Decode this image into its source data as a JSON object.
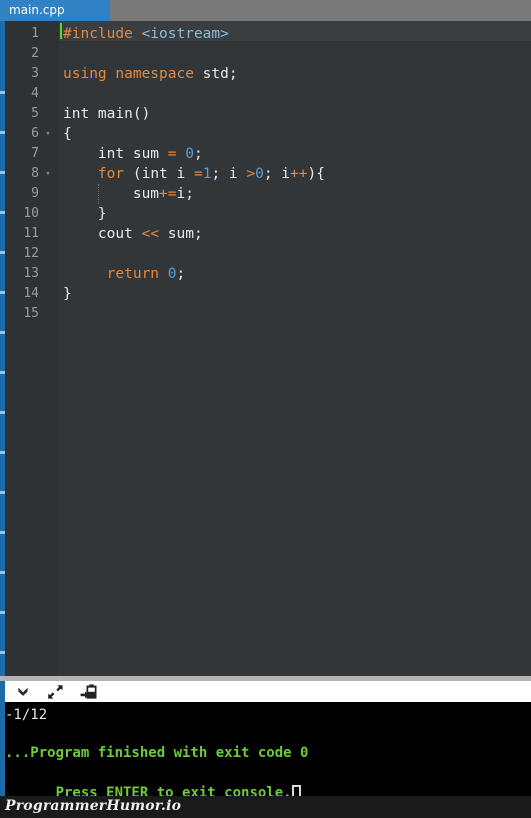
{
  "tabbar": {
    "active_tab": "main.cpp"
  },
  "editor": {
    "background": "#333638",
    "gutter_background": "#2f3234",
    "current_line_highlight": "#3b3e40",
    "cursor_color": "#4bdd2a",
    "colors": {
      "keyword": "#e8883a",
      "include_path": "#87bdd8",
      "number": "#5a9fd4",
      "plain": "#e8e8e8",
      "line_number": "#9a9c9d"
    },
    "lines": [
      {
        "num": "1",
        "fold": "",
        "indent": 0,
        "tokens": [
          {
            "t": "#include",
            "c": "k"
          },
          {
            "t": " ",
            "c": "p"
          },
          {
            "t": "<iostream>",
            "c": "s"
          }
        ]
      },
      {
        "num": "2",
        "fold": "",
        "indent": 0,
        "tokens": []
      },
      {
        "num": "3",
        "fold": "",
        "indent": 0,
        "tokens": [
          {
            "t": "using namespace",
            "c": "k"
          },
          {
            "t": " std;",
            "c": "p"
          }
        ]
      },
      {
        "num": "4",
        "fold": "",
        "indent": 0,
        "tokens": []
      },
      {
        "num": "5",
        "fold": "",
        "indent": 0,
        "tokens": [
          {
            "t": "int main()",
            "c": "p"
          }
        ]
      },
      {
        "num": "6",
        "fold": "▾",
        "indent": 0,
        "tokens": [
          {
            "t": "{",
            "c": "p"
          }
        ]
      },
      {
        "num": "7",
        "fold": "",
        "indent": 0,
        "tokens": [
          {
            "t": "    int sum ",
            "c": "p"
          },
          {
            "t": "=",
            "c": "k"
          },
          {
            "t": " ",
            "c": "p"
          },
          {
            "t": "0",
            "c": "n"
          },
          {
            "t": ";",
            "c": "p"
          }
        ]
      },
      {
        "num": "8",
        "fold": "▾",
        "indent": 0,
        "tokens": [
          {
            "t": "    ",
            "c": "p"
          },
          {
            "t": "for",
            "c": "k"
          },
          {
            "t": " (int i ",
            "c": "p"
          },
          {
            "t": "=",
            "c": "k"
          },
          {
            "t": "1",
            "c": "n"
          },
          {
            "t": "; i ",
            "c": "p"
          },
          {
            "t": ">",
            "c": "k"
          },
          {
            "t": "0",
            "c": "n"
          },
          {
            "t": "; i",
            "c": "p"
          },
          {
            "t": "++",
            "c": "k"
          },
          {
            "t": "){",
            "c": "p"
          }
        ]
      },
      {
        "num": "9",
        "fold": "",
        "indent": 1,
        "tokens": [
          {
            "t": "        sum",
            "c": "p"
          },
          {
            "t": "+=",
            "c": "k"
          },
          {
            "t": "i;",
            "c": "p"
          }
        ]
      },
      {
        "num": "10",
        "fold": "",
        "indent": 0,
        "tokens": [
          {
            "t": "    }",
            "c": "p"
          }
        ]
      },
      {
        "num": "11",
        "fold": "",
        "indent": 0,
        "tokens": [
          {
            "t": "    cout ",
            "c": "p"
          },
          {
            "t": "<<",
            "c": "k"
          },
          {
            "t": " sum;",
            "c": "p"
          }
        ]
      },
      {
        "num": "12",
        "fold": "",
        "indent": 0,
        "tokens": []
      },
      {
        "num": "13",
        "fold": "",
        "indent": 0,
        "tokens": [
          {
            "t": "     ",
            "c": "p"
          },
          {
            "t": "return",
            "c": "k"
          },
          {
            "t": " ",
            "c": "p"
          },
          {
            "t": "0",
            "c": "n"
          },
          {
            "t": ";",
            "c": "p"
          }
        ]
      },
      {
        "num": "14",
        "fold": "",
        "indent": 0,
        "tokens": [
          {
            "t": "}",
            "c": "p"
          }
        ]
      },
      {
        "num": "15",
        "fold": "",
        "indent": 0,
        "tokens": []
      }
    ]
  },
  "toolbar": {
    "buttons": [
      {
        "icon": "chevron-down-icon",
        "label": "Collapse console"
      },
      {
        "icon": "expand-arrows-icon",
        "label": "Maximize console"
      },
      {
        "icon": "save-export-icon",
        "label": "Export output"
      }
    ]
  },
  "console": {
    "status_line": "-1/12",
    "output_lines": [
      "...Program finished with exit code 0",
      "Press ENTER to exit console."
    ],
    "cursor_visible": true,
    "text_color": "#6ecb3c",
    "background": "#000000"
  },
  "watermark": {
    "text": "ProgrammerHumor.io"
  }
}
